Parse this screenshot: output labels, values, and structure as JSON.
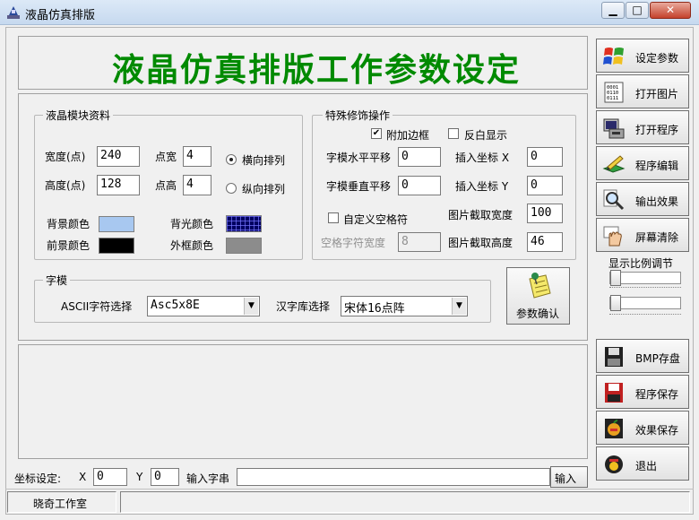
{
  "window": {
    "title": "液晶仿真排版",
    "controls": {
      "minimize": "▁",
      "maximize": "□",
      "close": "✕"
    }
  },
  "header": {
    "title": "液晶仿真排版工作参数设定"
  },
  "lcd_module": {
    "legend": "液晶模块资料",
    "width_label": "宽度(点)",
    "width_value": "240",
    "height_label": "高度(点)",
    "height_value": "128",
    "dot_width_label": "点宽",
    "dot_width_value": "4",
    "dot_height_label": "点高",
    "dot_height_value": "4",
    "horizontal_label": "横向排列",
    "vertical_label": "纵向排列",
    "orientation_selected": "horizontal",
    "bg_color_label": "背景颜色",
    "bg_color": "#a8c8f0",
    "fg_color_label": "前景颜色",
    "fg_color": "#000000",
    "backlight_label": "背光颜色",
    "backlight_color": "#00008b",
    "border_color_label": "外框颜色",
    "border_color": "#8c8c8c"
  },
  "special": {
    "legend": "特殊修饰操作",
    "add_border_label": "附加边框",
    "add_border_checked": true,
    "invert_label": "反白显示",
    "invert_checked": false,
    "h_shift_label": "字模水平平移",
    "h_shift_value": "0",
    "v_shift_label": "字模垂直平移",
    "v_shift_value": "0",
    "insert_x_label": "插入坐标 X",
    "insert_x_value": "0",
    "insert_y_label": "插入坐标 Y",
    "insert_y_value": "0",
    "custom_space_label": "自定义空格符",
    "custom_space_checked": false,
    "space_width_label": "空格字符宽度",
    "space_width_value": "8",
    "crop_width_label": "图片截取宽度",
    "crop_width_value": "100",
    "crop_height_label": "图片截取高度",
    "crop_height_value": "46"
  },
  "font": {
    "legend": "字模",
    "ascii_label": "ASCII字符选择",
    "ascii_value": "Asc5x8E",
    "hanzi_label": "汉字库选择",
    "hanzi_value": "宋体16点阵"
  },
  "confirm_button": {
    "label": "参数确认",
    "icon": "notepad-pin-icon"
  },
  "sidebar": {
    "top_buttons": [
      {
        "label": "设定参数",
        "icon": "windows-logo-icon"
      },
      {
        "label": "打开图片",
        "icon": "binary-file-icon"
      },
      {
        "label": "打开程序",
        "icon": "computer-disk-icon"
      },
      {
        "label": "程序编辑",
        "icon": "pen-edit-icon"
      },
      {
        "label": "输出效果",
        "icon": "magnifier-icon"
      },
      {
        "label": "屏幕清除",
        "icon": "hand-clear-icon"
      }
    ],
    "zoom_label": "显示比例调节",
    "zoom_level_1": 0.0,
    "zoom_level_2": 0.0,
    "bottom_buttons": [
      {
        "label": "BMP存盘",
        "icon": "floppy-icon"
      },
      {
        "label": "程序保存",
        "icon": "floppy-red-icon"
      },
      {
        "label": "效果保存",
        "icon": "apple-icon"
      },
      {
        "label": "退出",
        "icon": "exit-icon"
      }
    ]
  },
  "coord_bar": {
    "label": "坐标设定:",
    "x_label": "X",
    "x_value": "0",
    "y_label": "Y",
    "y_value": "0",
    "input_label": "输入字串",
    "input_value": "",
    "input_button": "输入"
  },
  "status": {
    "text": "晓奇工作室"
  }
}
